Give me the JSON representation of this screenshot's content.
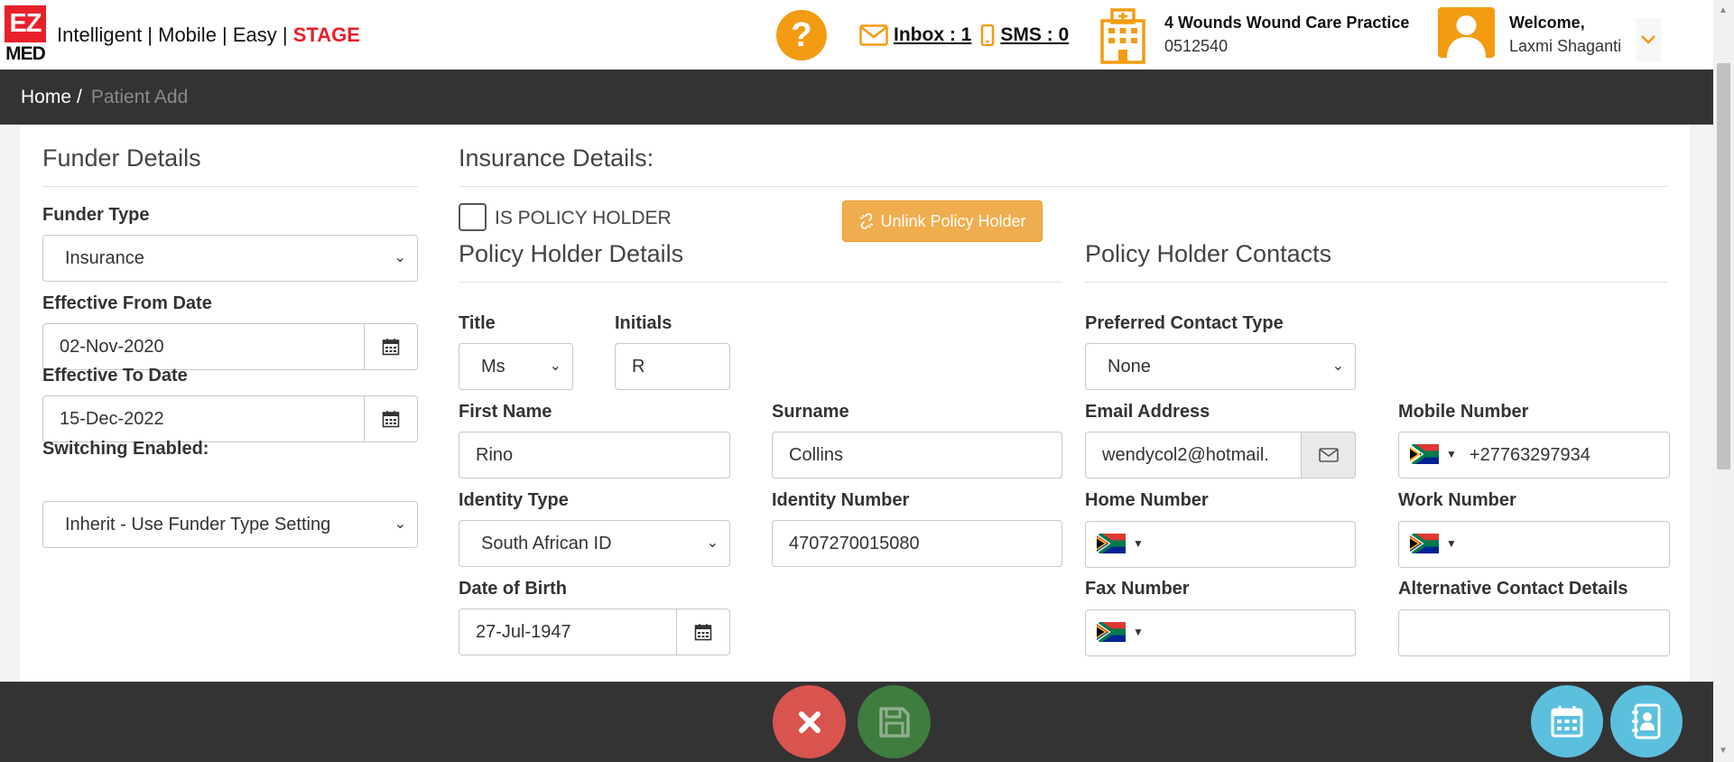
{
  "header": {
    "logo_top": "EZ",
    "logo_bottom": "MED",
    "tagline": "Intelligent | Mobile | Easy | ",
    "env_label": "STAGE",
    "help_symbol": "?",
    "inbox_label": " Inbox : 1",
    "sms_label": " SMS : 0",
    "practice_name": "4 Wounds Wound Care Practice",
    "practice_code": "0512540",
    "welcome_label": "Welcome,",
    "user_name": "Laxmi Shaganti",
    "user_menu_caret": "⌄"
  },
  "breadcrumb": {
    "home": "Home",
    "separator": "/",
    "current": "Patient Add"
  },
  "funder": {
    "title": "Funder Details",
    "type_label": "Funder Type",
    "type_value": "Insurance",
    "from_label": "Effective From Date",
    "from_value": "02-Nov-2020",
    "to_label": "Effective To Date",
    "to_value": "15-Dec-2022",
    "switching_label": "Switching Enabled:",
    "switching_value": "Inherit - Use Funder Type Setting"
  },
  "insurance": {
    "title": "Insurance Details:",
    "is_policy_holder_label": "IS POLICY HOLDER",
    "is_policy_holder_checked": false,
    "unlink_label": "Unlink Policy Holder"
  },
  "policy_holder": {
    "title": "Policy Holder Details",
    "title_label": "Title",
    "title_value": "Ms",
    "initials_label": "Initials",
    "initials_value": "R",
    "first_name_label": "First Name",
    "first_name_value": "Rino",
    "surname_label": "Surname",
    "surname_value": "Collins",
    "identity_type_label": "Identity Type",
    "identity_type_value": "South African ID",
    "identity_number_label": "Identity Number",
    "identity_number_value": "4707270015080",
    "dob_label": "Date of Birth",
    "dob_value": "27-Jul-1947"
  },
  "contacts": {
    "title": "Policy Holder Contacts",
    "preferred_label": "Preferred Contact Type",
    "preferred_value": "None",
    "email_label": "Email Address",
    "email_value": "wendycol2@hotmail.",
    "mobile_label": "Mobile Number",
    "mobile_value": "+27763297934",
    "home_label": "Home Number",
    "home_value": "",
    "work_label": "Work Number",
    "work_value": "",
    "fax_label": "Fax Number",
    "fax_value": "",
    "alt_label": "Alternative Contact Details",
    "alt_value": ""
  },
  "footer": {
    "cancel_icon": "close-icon",
    "save_icon": "floppy-disk-icon",
    "calendar_icon": "calendar-icon",
    "contacts_icon": "contact-book-icon"
  },
  "colors": {
    "brand_red": "#e8202a",
    "accent_orange": "#f39c12",
    "button_orange": "#f0ad4e",
    "dark_bar": "#333333",
    "cancel_red": "#d9534f",
    "save_green": "#3f7d3f",
    "info_blue": "#5bc0de"
  }
}
